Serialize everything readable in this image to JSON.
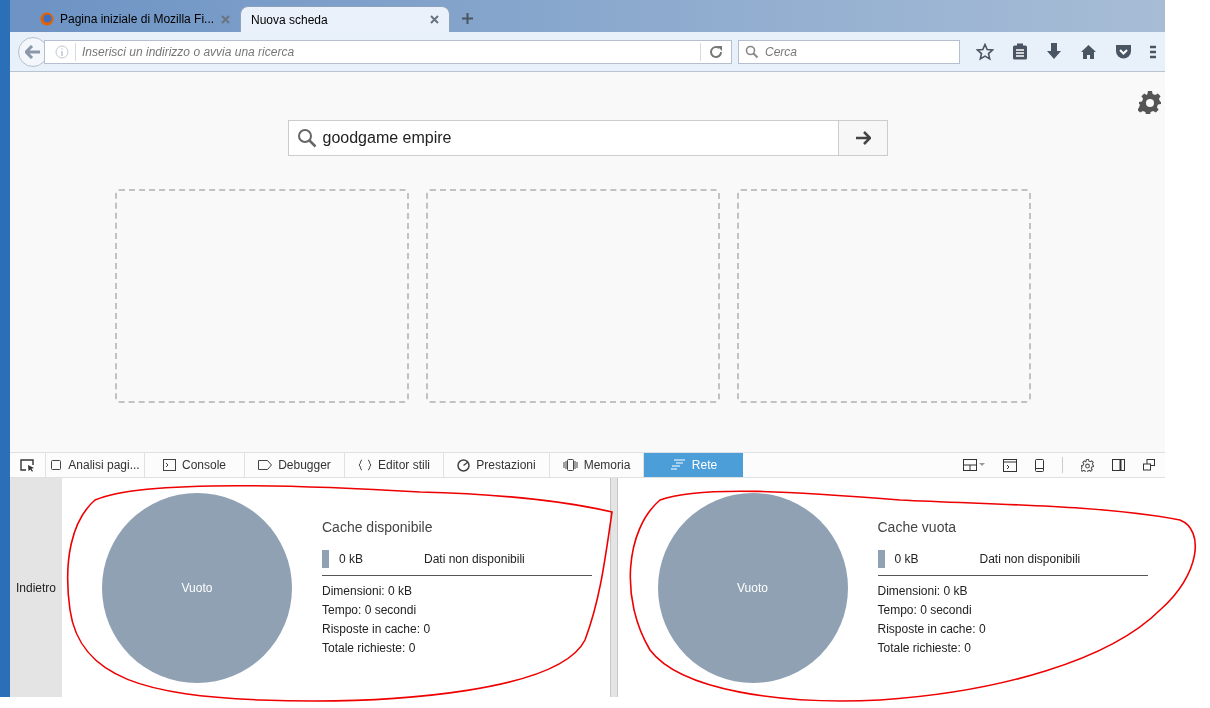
{
  "browser_tabs": [
    {
      "title": "Pagina iniziale di Mozilla Fi...",
      "selected": false
    },
    {
      "title": "Nuova scheda",
      "selected": true
    }
  ],
  "address_bar": {
    "placeholder": "Inserisci un indirizzo o avvia una ricerca"
  },
  "search_bar": {
    "placeholder": "Cerca"
  },
  "newtab_search": {
    "value": "goodgame empire"
  },
  "devtools_tabs": [
    {
      "label": "Analisi pagi...",
      "selected": false
    },
    {
      "label": "Console",
      "selected": false
    },
    {
      "label": "Debugger",
      "selected": false
    },
    {
      "label": "Editor stili",
      "selected": false
    },
    {
      "label": "Prestazioni",
      "selected": false
    },
    {
      "label": "Memoria",
      "selected": false
    },
    {
      "label": "Rete",
      "selected": true
    }
  ],
  "back_label": "Indietro",
  "cache_panels": [
    {
      "title": "Cache disponibile",
      "pie_label": "Vuoto",
      "size": "0 kB",
      "note": "Dati non disponibili",
      "stats": [
        "Dimensioni: 0 kB",
        "Tempo: 0 secondi",
        "Risposte in cache: 0",
        "Totale richieste: 0"
      ]
    },
    {
      "title": "Cache vuota",
      "pie_label": "Vuoto",
      "size": "0 kB",
      "note": "Dati non disponibili",
      "stats": [
        "Dimensioni: 0 kB",
        "Tempo: 0 secondi",
        "Risposte in cache: 0",
        "Totale richieste: 0"
      ]
    }
  ]
}
